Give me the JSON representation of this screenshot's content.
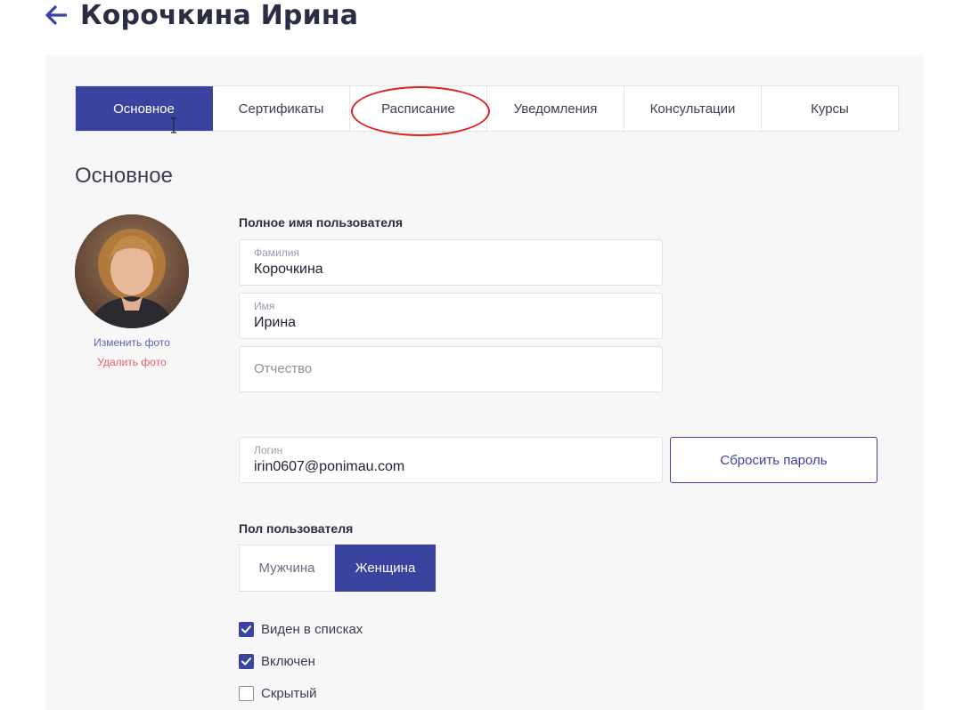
{
  "header": {
    "title": "Корочкина Ирина"
  },
  "tabs": [
    {
      "label": "Основное",
      "active": true
    },
    {
      "label": "Сертификаты",
      "active": false
    },
    {
      "label": "Расписание",
      "active": false
    },
    {
      "label": "Уведомления",
      "active": false
    },
    {
      "label": "Консультации",
      "active": false
    },
    {
      "label": "Курсы",
      "active": false
    }
  ],
  "section": {
    "title": "Основное"
  },
  "photo": {
    "change_label": "Изменить фото",
    "delete_label": "Удалить фото"
  },
  "full_name": {
    "heading": "Полное имя пользователя",
    "last_name": {
      "label": "Фамилия",
      "value": "Корочкина"
    },
    "first_name": {
      "label": "Имя",
      "value": "Ирина"
    },
    "middle_name": {
      "placeholder": "Отчество",
      "value": ""
    }
  },
  "login": {
    "label": "Логин",
    "value": "irin0607@ponimau.com",
    "reset_password_label": "Сбросить пароль"
  },
  "gender": {
    "heading": "Пол пользователя",
    "options": [
      {
        "label": "Мужчина",
        "selected": false
      },
      {
        "label": "Женщина",
        "selected": true
      }
    ]
  },
  "flags": [
    {
      "label": "Виден в списках",
      "checked": true
    },
    {
      "label": "Включен",
      "checked": true
    },
    {
      "label": "Скрытый",
      "checked": false
    }
  ],
  "colors": {
    "accent": "#3a43a0",
    "danger_link": "#f05a6b",
    "annotation": "#e01e1e"
  }
}
